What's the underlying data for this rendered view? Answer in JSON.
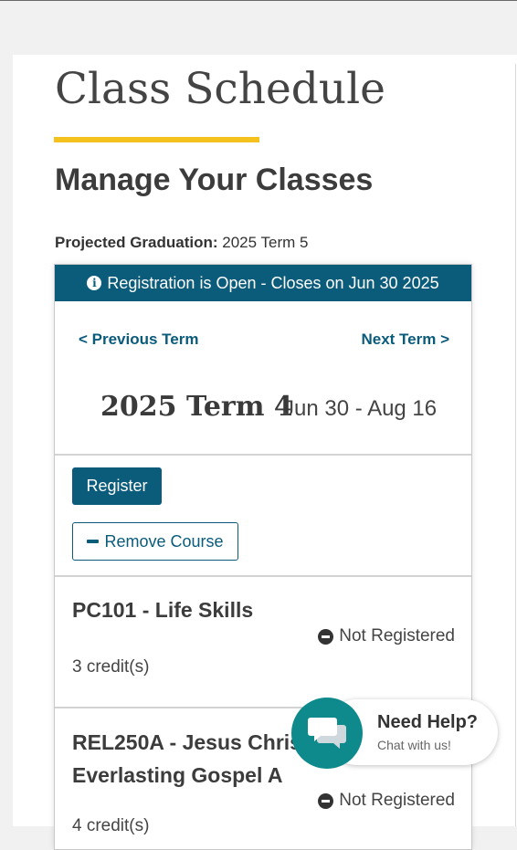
{
  "page": {
    "title": "Class Schedule",
    "subtitle": "Manage Your Classes",
    "graduation_label": "Projected Graduation:",
    "graduation_value": "2025 Term 5"
  },
  "term_card": {
    "banner": "Registration is Open - Closes on Jun 30 2025",
    "prev_link": "< Previous Term",
    "next_link": "Next Term >",
    "term_name": "2025 Term 4",
    "term_dates": "Jun 30 - Aug 16",
    "register_button": "Register",
    "remove_button": "Remove Course"
  },
  "courses": [
    {
      "title": "PC101 - Life Skills",
      "status": "Not Registered",
      "credits": "3 credit(s)"
    },
    {
      "title_line1": "REL250A - Jesus Christ and the",
      "title_line2": "Everlasting Gospel A",
      "status": "Not Registered",
      "credits": "4 credit(s)"
    }
  ],
  "help_widget": {
    "title": "Need Help?",
    "subtitle": "Chat with us!"
  },
  "colors": {
    "primary": "#0b5b7b",
    "accent": "#f5c11d",
    "help": "#0e8a8c"
  }
}
